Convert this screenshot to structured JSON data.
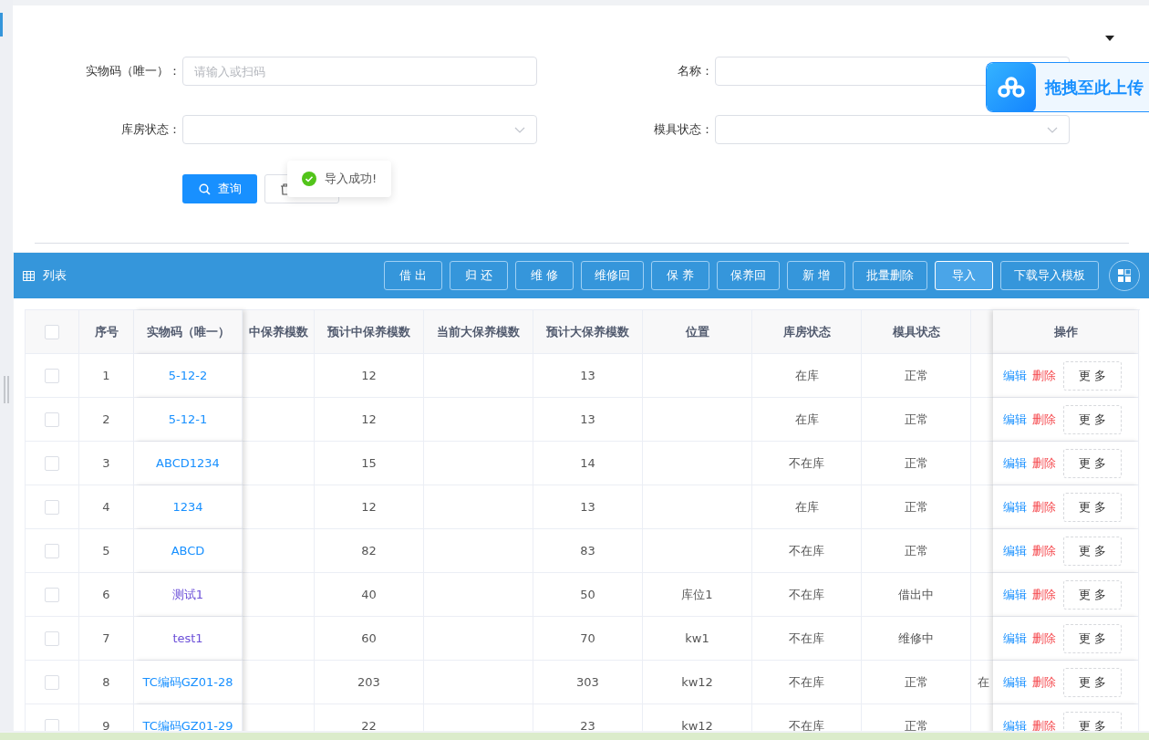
{
  "form": {
    "fields": [
      {
        "label": "实物码（唯一）：",
        "kind": "text",
        "placeholder": "请输入或扫码"
      },
      {
        "label": "名称：",
        "kind": "text"
      },
      {
        "label": "库房状态：",
        "kind": "select"
      },
      {
        "label": "模具状态：",
        "kind": "select"
      }
    ],
    "search_button": "查询"
  },
  "toast": {
    "kind": "success",
    "message": "导入成功!"
  },
  "upload_widget": {
    "label": "拖拽至此上传"
  },
  "list": {
    "title": "列表",
    "buttons": [
      {
        "label": "借 出",
        "highlighted": false
      },
      {
        "label": "归 还",
        "highlighted": false
      },
      {
        "label": "维 修",
        "highlighted": false
      },
      {
        "label": "维修回",
        "highlighted": false
      },
      {
        "label": "保 养",
        "highlighted": false
      },
      {
        "label": "保养回",
        "highlighted": false
      },
      {
        "label": "新 增",
        "highlighted": false
      },
      {
        "label": "批量删除",
        "highlighted": false
      },
      {
        "label": "导入",
        "highlighted": true
      },
      {
        "label": "下载导入模板",
        "highlighted": false
      }
    ]
  },
  "table": {
    "header_checked": false,
    "columns": [
      "序号",
      "实物码（唯一）",
      "中保养模数",
      "预计中保养模数",
      "当前大保养模数",
      "预计大保养模数",
      "位置",
      "库房状态",
      "模具状态",
      null,
      "操作"
    ],
    "rows": [
      {
        "checked": false,
        "visited": false,
        "cells": [
          "1",
          "5-12-2",
          null,
          "12",
          null,
          "13",
          null,
          "在库",
          "正常",
          null
        ],
        "actions": [
          "编辑",
          "删除",
          "更 多"
        ]
      },
      {
        "checked": false,
        "visited": false,
        "cells": [
          "2",
          "5-12-1",
          null,
          "12",
          null,
          "13",
          null,
          "在库",
          "正常",
          null
        ],
        "actions": [
          "编辑",
          "删除",
          "更 多"
        ]
      },
      {
        "checked": false,
        "visited": false,
        "cells": [
          "3",
          "ABCD1234",
          null,
          "15",
          null,
          "14",
          null,
          "不在库",
          "正常",
          null
        ],
        "actions": [
          "编辑",
          "删除",
          "更 多"
        ]
      },
      {
        "checked": false,
        "visited": false,
        "cells": [
          "4",
          "1234",
          null,
          "12",
          null,
          "13",
          null,
          "在库",
          "正常",
          null
        ],
        "actions": [
          "编辑",
          "删除",
          "更 多"
        ]
      },
      {
        "checked": false,
        "visited": false,
        "cells": [
          "5",
          "ABCD",
          null,
          "82",
          null,
          "83",
          null,
          "不在库",
          "正常",
          null
        ],
        "actions": [
          "编辑",
          "删除",
          "更 多"
        ]
      },
      {
        "checked": false,
        "visited": true,
        "cells": [
          "6",
          "测试1",
          null,
          "40",
          null,
          "50",
          "库位1",
          "不在库",
          "借出中",
          null
        ],
        "actions": [
          "编辑",
          "删除",
          "更 多"
        ]
      },
      {
        "checked": false,
        "visited": true,
        "cells": [
          "7",
          "test1",
          null,
          "60",
          null,
          "70",
          "kw1",
          "不在库",
          "维修中",
          null
        ],
        "actions": [
          "编辑",
          "删除",
          "更 多"
        ]
      },
      {
        "checked": false,
        "visited": false,
        "cells": [
          "8",
          "TC编码GZ01-28",
          null,
          "203",
          null,
          "303",
          "kw12",
          "不在库",
          "正常",
          "在"
        ],
        "actions": [
          "编辑",
          "删除",
          "更 多"
        ]
      },
      {
        "checked": false,
        "visited": false,
        "cells": [
          "9",
          "TC编码GZ01-29",
          null,
          "22",
          null,
          "23",
          "kw12",
          "不在库",
          "正常",
          null
        ],
        "actions": [
          "编辑",
          "删除",
          "更 多"
        ]
      }
    ]
  }
}
